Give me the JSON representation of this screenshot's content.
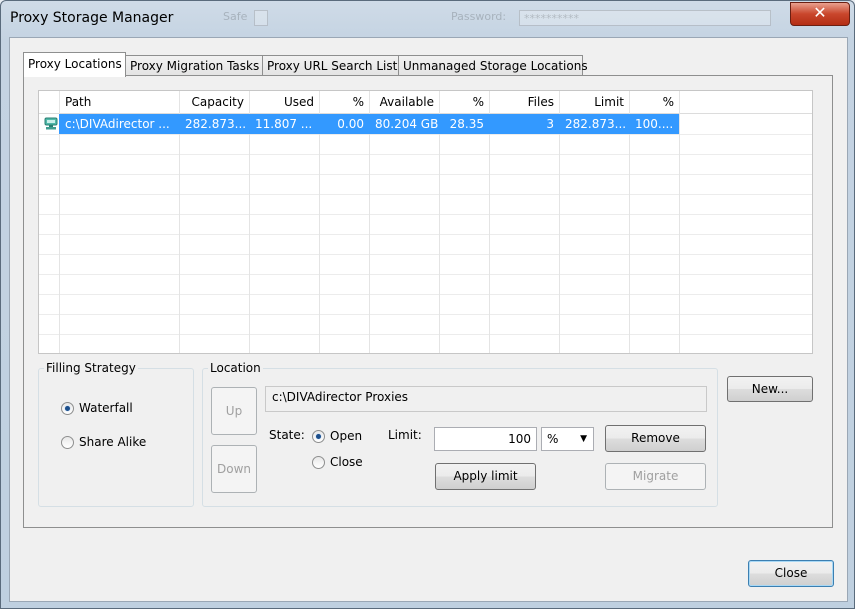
{
  "window": {
    "title": "Proxy Storage Manager"
  },
  "background": {
    "ghost_label_1": "Safe",
    "ghost_label_2": "Password:",
    "ghost_value": "**********"
  },
  "tabs": [
    {
      "label": "Proxy Locations",
      "active": true
    },
    {
      "label": "Proxy Migration Tasks",
      "active": false
    },
    {
      "label": "Proxy URL Search List",
      "active": false
    },
    {
      "label": "Unmanaged Storage Locations",
      "active": false
    }
  ],
  "table": {
    "columns": [
      "Path",
      "Capacity",
      "Used",
      "%",
      "Available",
      "%",
      "Files",
      "Limit",
      "%"
    ],
    "rows": [
      {
        "path": "c:\\DIVAdirector ...",
        "capacity": "282.873...",
        "used": "11.807 ...",
        "used_pct": "0.00",
        "available": "80.204 GB",
        "avail_pct": "28.35",
        "files": "3",
        "limit": "282.873...",
        "limit_pct": "100...."
      }
    ]
  },
  "filling": {
    "legend": "Filling Strategy",
    "options": [
      {
        "label": "Waterfall",
        "selected": true
      },
      {
        "label": "Share Alike",
        "selected": false
      }
    ]
  },
  "location": {
    "legend": "Location",
    "up_label": "Up",
    "down_label": "Down",
    "path_value": "c:\\DIVAdirector Proxies",
    "state_label": "State:",
    "state_open": "Open",
    "state_close": "Close",
    "limit_label": "Limit:",
    "limit_value": "100",
    "unit_value": "%",
    "remove_label": "Remove",
    "apply_label": "Apply limit",
    "migrate_label": "Migrate"
  },
  "buttons": {
    "new_label": "New...",
    "close_label": "Close"
  }
}
